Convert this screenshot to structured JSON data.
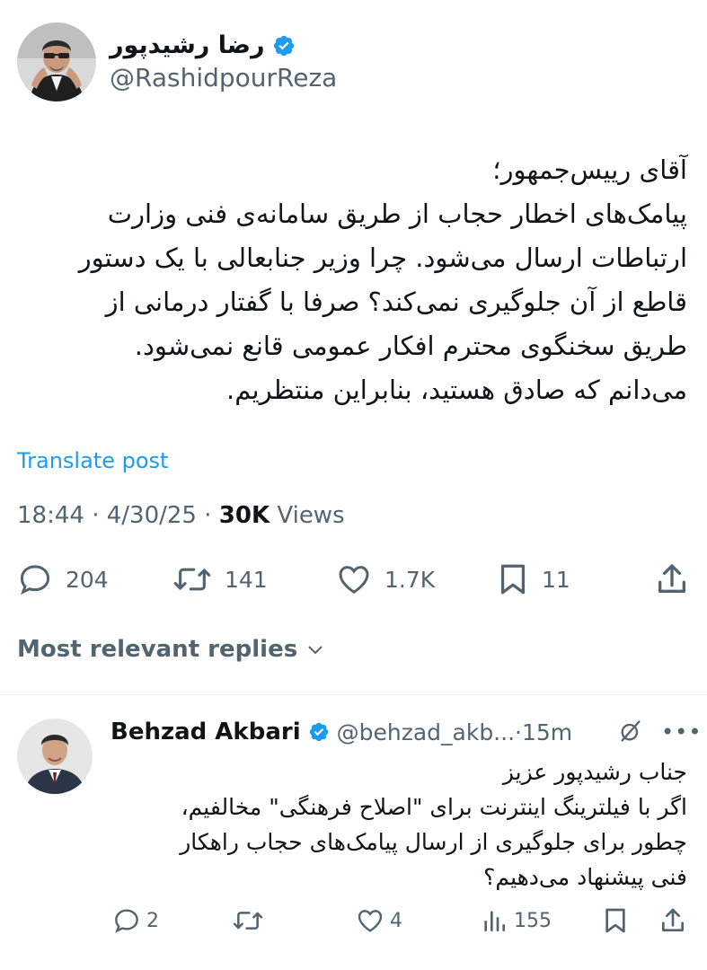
{
  "post": {
    "author_name": "رضا رشیدپور",
    "author_handle": "@RashidpourReza",
    "body_lines": [
      "آقای رییس‌جمهور؛",
      "پیامک‌های اخطار حجاب از طریق سامانه‌ی فنی وزارت",
      "ارتباطات ارسال می‌شود. چرا وزیر جنابعالی با یک دستور",
      "قاطع از آن جلوگیری نمی‌کند؟ صرفا با گفتار درمانی از",
      "طریق سخنگوی محترم افکار عمومی قانع نمی‌شود.",
      "می‌دانم که صادق هستید، بنابراین منتظریم."
    ],
    "translate_label": "Translate post",
    "time": "18:44",
    "date": "4/30/25",
    "views_count": "30K",
    "views_label": "Views",
    "separator": " · ",
    "replies_count": "204",
    "reposts_count": "141",
    "likes_count": "1.7K",
    "bookmarks_count": "11"
  },
  "replies_sort_label": "Most relevant replies",
  "reply": {
    "author_name": "Behzad Akbari",
    "author_handle": "@behzad_akb...",
    "time_ago": "15m",
    "body_lines": [
      "جناب رشیدپور عزیز",
      "اگر با فیلترینگ اینترنت برای \"اصلاح فرهنگی\" مخالفیم،",
      "چطور برای جلوگیری از ارسال پیامک‌های حجاب راهکار",
      "فنی پیشنهاد می‌دهیم؟"
    ],
    "replies_count": "2",
    "likes_count": "4",
    "views_count": "155"
  },
  "colors": {
    "text": "#0f1419",
    "secondary": "#536471",
    "link": "#1d9bf0",
    "verified": "#1d9bf0",
    "divider": "#eff3f4"
  },
  "icons": [
    "verified-badge-icon",
    "reply-icon",
    "repost-icon",
    "like-icon",
    "bookmark-icon",
    "share-icon",
    "chevron-down-icon",
    "grok-icon",
    "more-icon",
    "views-icon"
  ]
}
